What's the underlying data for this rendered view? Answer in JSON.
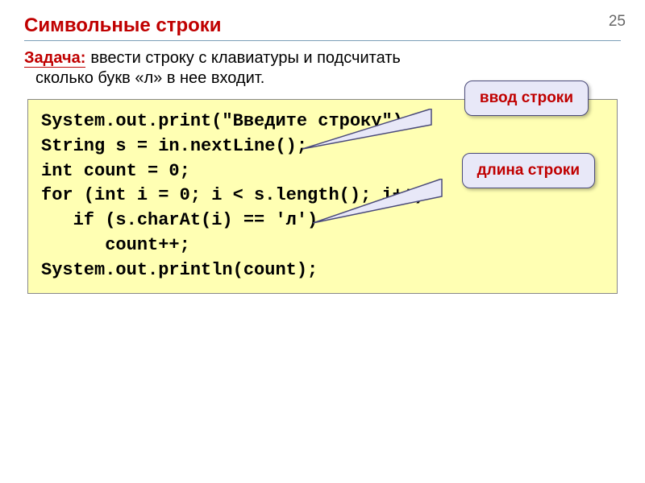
{
  "page_number": "25",
  "title": "Символьные строки",
  "task": {
    "label": "Задача:",
    "text1": "ввести строку с клавиатуры и подсчитать",
    "text2": "сколько букв «л» в нее входит."
  },
  "callouts": {
    "c1": "ввод строки",
    "c2": "длина строки"
  },
  "code": {
    "l1": "System.out.print(\"Введите строку\");",
    "l2": "String s = in.nextLine();",
    "l3": "int count = 0;",
    "l4": "for (int i = 0; i < s.length(); i++)",
    "l5": "   if (s.charAt(i) == 'л')",
    "l6": "      count++;",
    "l7": "System.out.println(count);"
  }
}
